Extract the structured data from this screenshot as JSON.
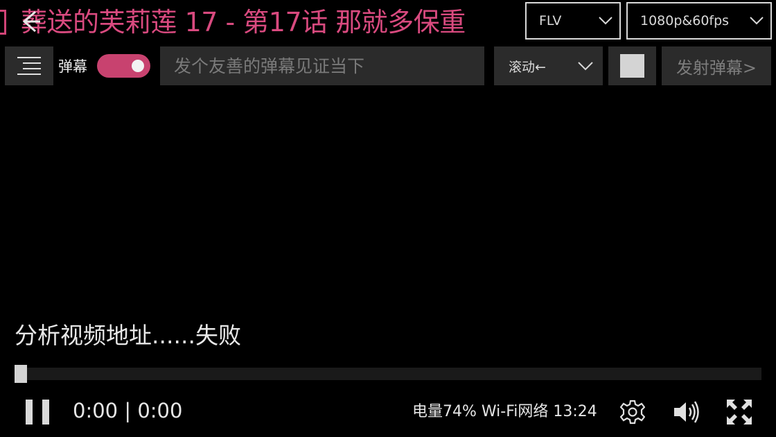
{
  "header": {
    "title": "葬送的芙莉莲 17 - 第17话 那就多保重",
    "back_icon": "arrow-left-icon",
    "format_select": {
      "value": "FLV"
    },
    "quality_select": {
      "value": "1080p&60fps"
    }
  },
  "danmaku_bar": {
    "menu_icon": "hamburger-menu-icon",
    "toggle_label": "弹幕",
    "toggle_on": true,
    "input_placeholder": "发个友善的弹幕见证当下",
    "input_value": "",
    "mode_select": {
      "value": "滚动←"
    },
    "color_swatch": "#d4d4d4",
    "send_label": "发射弹幕>"
  },
  "player": {
    "status_message": "分析视频地址......失败",
    "progress_fraction": 0.0,
    "time_display": "0:00 | 0:00",
    "system_status": "电量74% Wi-Fi网络 13:24",
    "icons": {
      "play_state": "pause-icon",
      "settings": "gear-icon",
      "volume": "volume-icon",
      "fullscreen": "fullscreen-icon"
    }
  },
  "colors": {
    "accent": "#d94a7f",
    "toggle_on": "#c8426f",
    "control_bg": "#2b2b2b",
    "background": "#000000"
  }
}
